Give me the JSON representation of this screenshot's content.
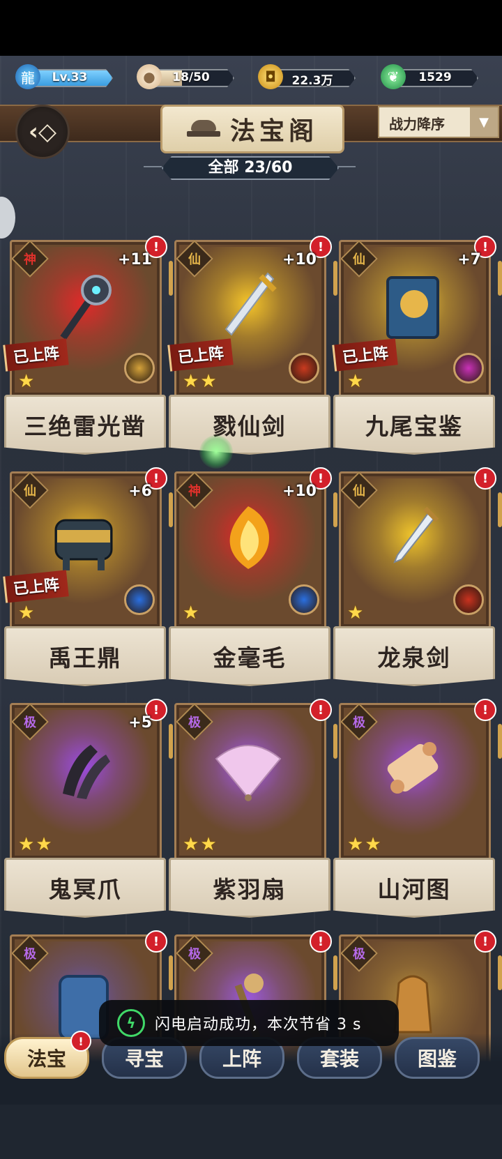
{
  "resources": [
    {
      "id": "level",
      "label": "Lv.33",
      "icon": "dragon-level-icon",
      "fill_percent": 100
    },
    {
      "id": "stamina",
      "label": "18/50",
      "icon": "bun-icon",
      "fill_percent": 36
    },
    {
      "id": "coins",
      "label": "22.3万",
      "icon": "coin-icon",
      "fill_percent": 0
    },
    {
      "id": "jade",
      "label": "1529",
      "icon": "jade-leaf-icon",
      "fill_percent": 0
    }
  ],
  "header": {
    "title": "法宝阁",
    "sort_label": "战力降序",
    "count_label": "全部 23/60"
  },
  "cards": [
    {
      "name": "三绝雷光凿",
      "tier": "神",
      "tier_color": "#e0312b",
      "plus": "+11",
      "deployed": "已上阵",
      "stars": 1,
      "glow": "#e02a2a",
      "skill_color": "#d4a23a",
      "item_icon": "thunder-mace-icon"
    },
    {
      "name": "戮仙剑",
      "tier": "仙",
      "tier_color": "#e6b64a",
      "plus": "+10",
      "deployed": "已上阵",
      "stars": 2,
      "glow": "#f5c52a",
      "skill_color": "#c93a1f",
      "item_icon": "golden-sword-icon"
    },
    {
      "name": "九尾宝鉴",
      "tier": "仙",
      "tier_color": "#e6b64a",
      "plus": "+7",
      "deployed": "已上阵",
      "stars": 1,
      "glow": "#f0c634",
      "skill_color": "#c931b8",
      "item_icon": "book-icon"
    },
    {
      "name": "禹王鼎",
      "tier": "仙",
      "tier_color": "#e6b64a",
      "plus": "+6",
      "deployed": "已上阵",
      "stars": 1,
      "glow": "#e8b72c",
      "skill_color": "#2a6fe0",
      "item_icon": "cauldron-icon"
    },
    {
      "name": "金毫毛",
      "tier": "神",
      "tier_color": "#e0312b",
      "plus": "+10",
      "deployed": "",
      "stars": 1,
      "glow": "#e22828",
      "skill_color": "#2a6fe0",
      "item_icon": "flame-hair-icon"
    },
    {
      "name": "龙泉剑",
      "tier": "仙",
      "tier_color": "#e6b64a",
      "plus": "",
      "deployed": "",
      "stars": 1,
      "glow": "#f0c52c",
      "skill_color": "#c9321f",
      "item_icon": "dagger-icon"
    },
    {
      "name": "鬼冥爪",
      "tier": "极",
      "tier_color": "#b569e8",
      "plus": "+5",
      "deployed": "",
      "stars": 2,
      "glow": "#9b4be0",
      "skill_color": "",
      "item_icon": "claw-icon"
    },
    {
      "name": "紫羽扇",
      "tier": "极",
      "tier_color": "#b569e8",
      "plus": "",
      "deployed": "",
      "stars": 2,
      "glow": "#a259e6",
      "skill_color": "",
      "item_icon": "fan-icon"
    },
    {
      "name": "山河图",
      "tier": "极",
      "tier_color": "#b569e8",
      "plus": "",
      "deployed": "",
      "stars": 2,
      "glow": "#a04fe0",
      "skill_color": "",
      "item_icon": "scroll-icon"
    },
    {
      "name": "",
      "tier": "极",
      "tier_color": "#b569e8",
      "plus": "",
      "deployed": "",
      "stars": 0,
      "glow": "#6a57b0",
      "skill_color": "",
      "item_icon": "armor-icon"
    },
    {
      "name": "",
      "tier": "极",
      "tier_color": "#b569e8",
      "plus": "",
      "deployed": "",
      "stars": 0,
      "glow": "#9a59d8",
      "skill_color": "",
      "item_icon": "staff-icon"
    },
    {
      "name": "",
      "tier": "极",
      "tier_color": "#b569e8",
      "plus": "",
      "deployed": "",
      "stars": 0,
      "glow": "#b48a3a",
      "skill_color": "",
      "item_icon": "bell-icon"
    }
  ],
  "toast": {
    "message": "闪电启动成功，本次节省 3 s",
    "icon": "lightning-icon"
  },
  "tabs": [
    {
      "label": "法宝",
      "active": true,
      "alert": "!"
    },
    {
      "label": "寻宝",
      "active": false,
      "alert": ""
    },
    {
      "label": "上阵",
      "active": false,
      "alert": ""
    },
    {
      "label": "套装",
      "active": false,
      "alert": ""
    },
    {
      "label": "图鉴",
      "active": false,
      "alert": ""
    }
  ],
  "alert_mark": "!"
}
